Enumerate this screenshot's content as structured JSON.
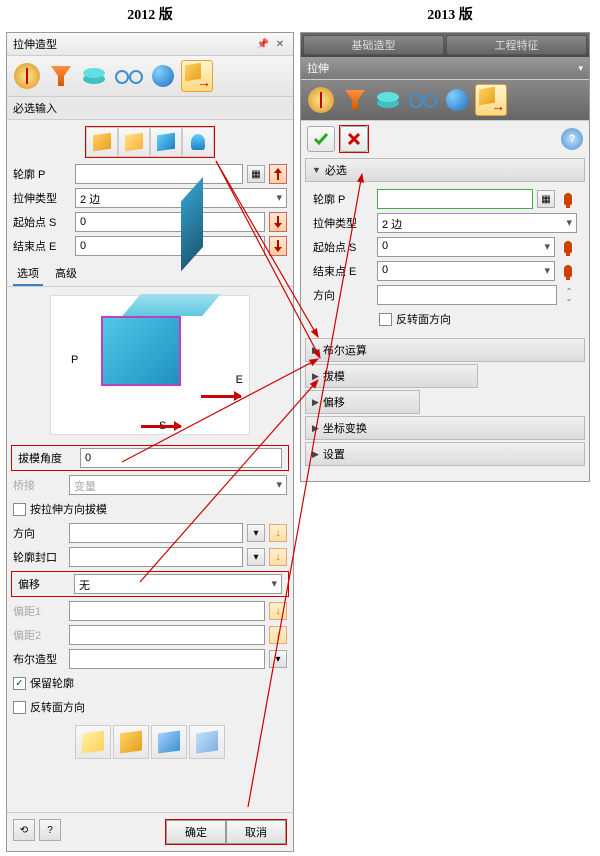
{
  "headers": {
    "v2012": "2012 版",
    "v2013": "2013 版"
  },
  "left": {
    "title": "拉伸造型",
    "section_required": "必选输入",
    "fields": {
      "profile": {
        "label": "轮廓 P",
        "value": ""
      },
      "type": {
        "label": "拉伸类型",
        "value": "2 边"
      },
      "start": {
        "label": "起始点 S",
        "value": "0"
      },
      "end": {
        "label": "结束点 E",
        "value": "0"
      }
    },
    "tabs": {
      "options": "选项",
      "advanced": "高级"
    },
    "preview_labels": {
      "p": "P",
      "e": "E",
      "s": "S"
    },
    "draft": {
      "label": "拔模角度",
      "value": "0"
    },
    "bridge": {
      "label": "桥接",
      "value": "变量"
    },
    "cb_draft_dir": "按拉伸方向拔模",
    "direction": {
      "label": "方向"
    },
    "cap": {
      "label": "轮廓封口"
    },
    "offset": {
      "label": "偏移",
      "value": "无"
    },
    "offset1": {
      "label": "偏距1"
    },
    "offset2": {
      "label": "偏距2"
    },
    "boolean": {
      "label": "布尔造型"
    },
    "cb_keep_profile": "保留轮廓",
    "cb_flip": "反转面方向",
    "ok": "确定",
    "cancel": "取消"
  },
  "right": {
    "ribbon": {
      "b1": "基础造型",
      "b2": "工程特征"
    },
    "title": "拉伸",
    "sections": {
      "required": "必选",
      "boolean": "布尔运算",
      "draft": "拔模",
      "offset": "偏移",
      "coord": "坐标变换",
      "settings": "设置"
    },
    "fields": {
      "profile": {
        "label": "轮廓 P",
        "value": ""
      },
      "type": {
        "label": "拉伸类型",
        "value": "2 边"
      },
      "start": {
        "label": "起始点 S",
        "value": "0"
      },
      "end": {
        "label": "结束点 E",
        "value": "0"
      },
      "direction": {
        "label": "方向"
      },
      "cb_flip": "反转面方向"
    }
  }
}
